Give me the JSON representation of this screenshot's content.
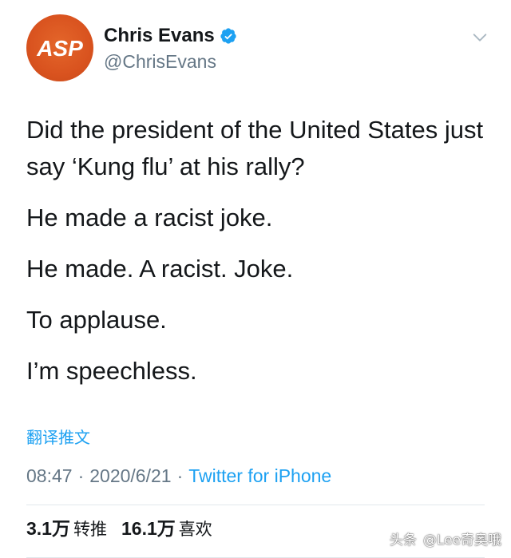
{
  "profile": {
    "display_name": "Chris Evans",
    "handle": "@ChrisEvans",
    "avatar_text": "ASP",
    "avatar_color": "#d9531f",
    "verified_color": "#1da1f2"
  },
  "tweet": {
    "paragraphs": [
      "Did the president of the United States just say ‘Kung flu’ at his rally?",
      "He made a racist joke.",
      "He made. A racist. Joke.",
      "To applause.",
      "I’m speechless."
    ],
    "translate_label": "翻译推文"
  },
  "meta": {
    "time": "08:47",
    "separator": "·",
    "date": "2020/6/21",
    "source": "Twitter for iPhone"
  },
  "stats": {
    "retweets_count": "3.1万",
    "retweets_label": "转推",
    "likes_count": "16.1万",
    "likes_label": "喜欢"
  },
  "watermark": {
    "brand": "头条",
    "account": "@Lee奇奥哦"
  },
  "colors": {
    "link": "#1da1f2",
    "secondary_text": "#657786",
    "primary_text": "#14171a",
    "divider": "#e1e8ed"
  },
  "icons": {
    "verified": "verified-badge-icon",
    "menu": "chevron-down-icon"
  }
}
